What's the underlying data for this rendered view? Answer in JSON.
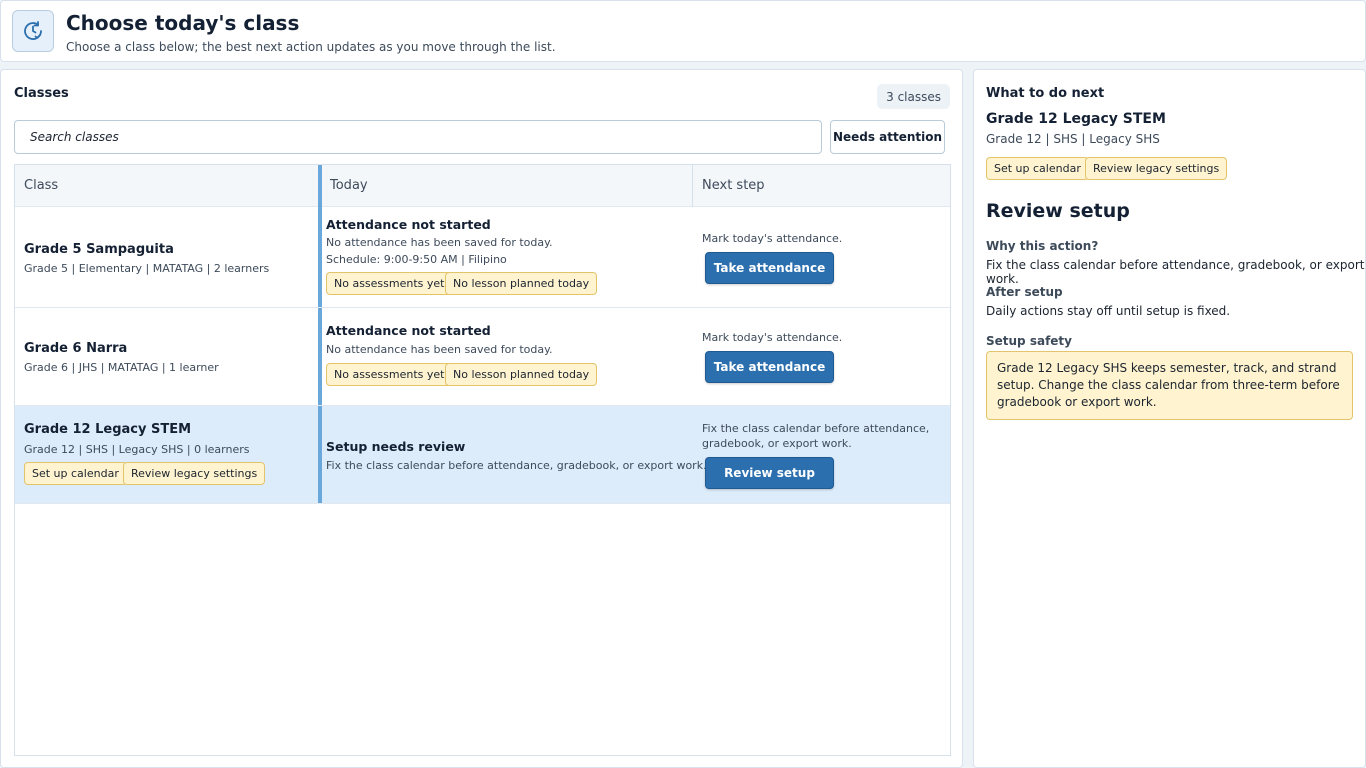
{
  "header": {
    "icon": "clock-check-icon",
    "title": "Choose today's class",
    "subtitle": "Choose a class below; the best next action updates as you move through the list."
  },
  "classes_panel": {
    "title": "Classes",
    "count_badge": "3 classes",
    "search_placeholder": "Search classes",
    "search_value": "",
    "filter_button": "Needs attention",
    "columns": [
      "Class",
      "Today",
      "Next step"
    ]
  },
  "rows": [
    {
      "name": "Grade 5 Sampaguita",
      "meta": "Grade 5 | Elementary | MATATAG | 2 learners",
      "today_title": "Attendance not started",
      "today_line1": "No attendance has been saved for today.",
      "today_line2": "Schedule: 9:00-9:50 AM | Filipino",
      "chips": [
        "No assessments yet",
        "No lesson planned today"
      ],
      "next_hint": "Mark today's attendance.",
      "action": "Take attendance"
    },
    {
      "name": "Grade 6 Narra",
      "meta": "Grade 6 | JHS | MATATAG | 1 learner",
      "today_title": "Attendance not started",
      "today_line1": "No attendance has been saved for today.",
      "chips": [
        "No assessments yet",
        "No lesson planned today"
      ],
      "next_hint": "Mark today's attendance.",
      "action": "Take attendance"
    },
    {
      "name": "Grade 12 Legacy STEM",
      "meta": "Grade 12 | SHS | Legacy SHS | 0 learners",
      "class_chips": [
        "Set up calendar",
        "Review legacy settings"
      ],
      "today_title": "Setup needs review",
      "today_line1": "Fix the class calendar before attendance, gradebook, or export work.",
      "next_hint": "Fix the class calendar before attendance, gradebook, or export work.",
      "action": "Review setup",
      "selected": true
    }
  ],
  "next_panel": {
    "title": "What to do next",
    "class_name": "Grade 12 Legacy STEM",
    "class_meta": "Grade 12 | SHS | Legacy SHS",
    "chips": [
      "Set up calendar",
      "Review legacy settings"
    ],
    "action_title": "Review setup",
    "why_label": "Why this action?",
    "why_text": "Fix the class calendar before attendance, gradebook, or export work.",
    "after_label": "After setup",
    "after_text": "Daily actions stay off until setup is fixed.",
    "safety_label": "Setup safety",
    "safety_text": "Grade 12 Legacy SHS keeps semester, track, and strand setup. Change the class calendar from three-term before gradebook or export work."
  },
  "colors": {
    "accent": "#2c6fae",
    "selected_row": "#ddecfb",
    "chip_bg": "#fff4cf",
    "chip_border": "#e3c46a",
    "today_bar": "#6aa8dc"
  }
}
